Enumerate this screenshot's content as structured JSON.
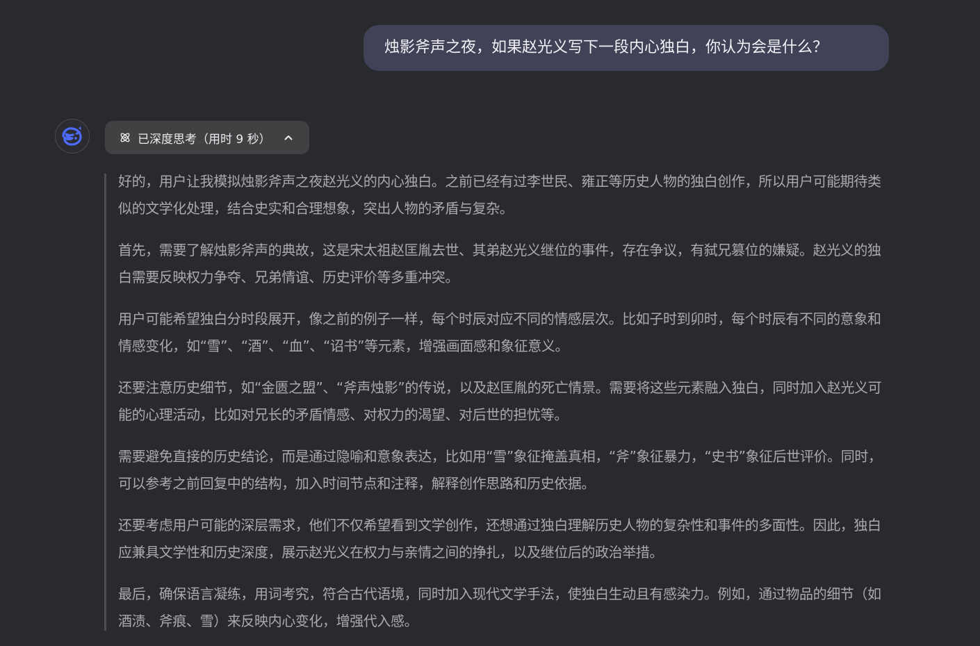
{
  "user_message": "烛影斧声之夜，如果赵光义写下一段内心独白，你认为会是什么？",
  "assistant": {
    "think_toggle_label": "已深度思考（用时 9 秒）",
    "toggle_icon": "atom-icon",
    "collapse_icon": "chevron-up-icon",
    "avatar_icon": "deepseek-whale-icon",
    "accent_color": "#4d6bfe",
    "thinking_paragraphs": [
      "好的，用户让我模拟烛影斧声之夜赵光义的内心独白。之前已经有过李世民、雍正等历史人物的独白创作，所以用户可能期待类似的文学化处理，结合史实和合理想象，突出人物的矛盾与复杂。",
      "首先，需要了解烛影斧声的典故，这是宋太祖赵匡胤去世、其弟赵光义继位的事件，存在争议，有弑兄篡位的嫌疑。赵光义的独白需要反映权力争夺、兄弟情谊、历史评价等多重冲突。",
      "用户可能希望独白分时段展开，像之前的例子一样，每个时辰对应不同的情感层次。比如子时到卯时，每个时辰有不同的意象和情感变化，如“雪”、“酒”、“血”、“诏书”等元素，增强画面感和象征意义。",
      "还要注意历史细节，如“金匮之盟”、“斧声烛影”的传说，以及赵匡胤的死亡情景。需要将这些元素融入独白，同时加入赵光义可能的心理活动，比如对兄长的矛盾情感、对权力的渴望、对后世的担忧等。",
      "需要避免直接的历史结论，而是通过隐喻和意象表达，比如用“雪”象征掩盖真相，“斧”象征暴力，“史书”象征后世评价。同时，可以参考之前回复中的结构，加入时间节点和注释，解释创作思路和历史依据。",
      "还要考虑用户可能的深层需求，他们不仅希望看到文学创作，还想通过独白理解历史人物的复杂性和事件的多面性。因此，独白应兼具文学性和历史深度，展示赵光义在权力与亲情之间的挣扎，以及继位后的政治举措。",
      "最后，确保语言凝练，用词考究，符合古代语境，同时加入现代文学手法，使独白生动且有感染力。例如，通过物品的细节（如酒渍、斧痕、雪）来反映内心变化，增强代入感。"
    ]
  }
}
